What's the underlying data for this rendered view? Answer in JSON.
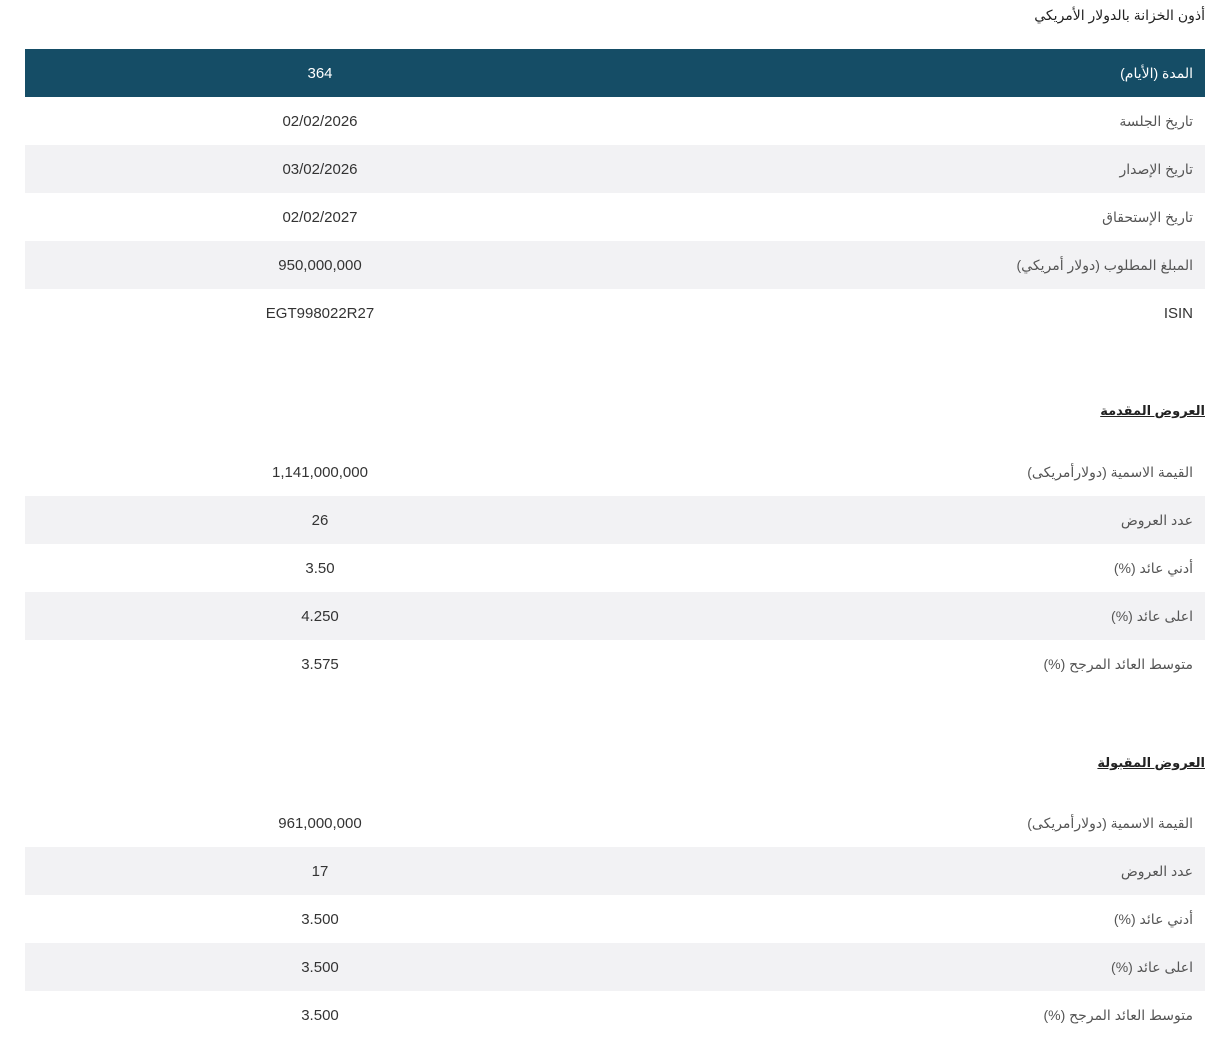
{
  "title": "أذون الخزانة بالدولار الأمريكي",
  "main_table": {
    "header": {
      "label": "المدة (الأيام)",
      "value": "364"
    },
    "rows": [
      {
        "label": "تاريخ الجلسة",
        "value": "02/02/2026"
      },
      {
        "label": "تاريخ الإصدار",
        "value": "03/02/2026"
      },
      {
        "label": "تاريخ الإستحقاق",
        "value": "02/02/2027"
      },
      {
        "label": "المبلغ المطلوب (دولار أمريكي)",
        "value": "950,000,000"
      },
      {
        "label": "ISIN",
        "value": "EGT998022R27"
      }
    ]
  },
  "offered": {
    "heading": "العروض المقدمة",
    "rows": [
      {
        "label": "القيمة الاسمية (دولارأمريكى)",
        "value": "1,141,000,000"
      },
      {
        "label": "عدد العروض",
        "value": "26"
      },
      {
        "label": "أدني عائد (%)",
        "value": "3.50"
      },
      {
        "label": "اعلى عائد (%)",
        "value": "4.250"
      },
      {
        "label": "متوسط العائد المرجح (%)",
        "value": "3.575"
      }
    ]
  },
  "accepted": {
    "heading": "العروض المقبولة",
    "rows": [
      {
        "label": "القيمة الاسمية (دولارأمريكى)",
        "value": "961,000,000"
      },
      {
        "label": "عدد العروض",
        "value": "17"
      },
      {
        "label": "أدني عائد (%)",
        "value": "3.500"
      },
      {
        "label": "اعلى عائد (%)",
        "value": "3.500"
      },
      {
        "label": "متوسط العائد المرجح (%)",
        "value": "3.500"
      }
    ]
  },
  "colors": {
    "header_background": "#154d66",
    "shaded_row": "#f2f2f4"
  }
}
